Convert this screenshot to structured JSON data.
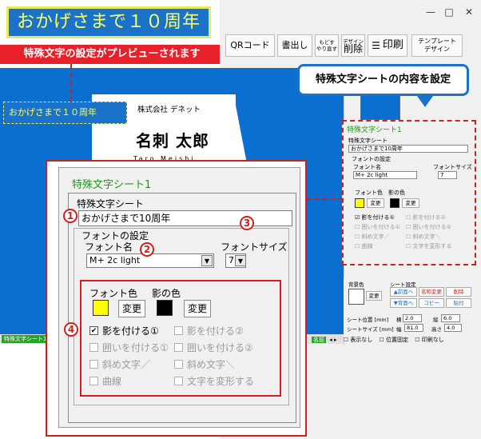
{
  "preview_banner": {
    "text": "おかげさまで１０周年",
    "caption": "特殊文字の設定がプレビューされます"
  },
  "window": {
    "minimize": "—",
    "maximize": "□",
    "close": "✕"
  },
  "toolbar": {
    "qr": "QRコード",
    "write": "書出し",
    "undo_line1": "もどす",
    "undo_line2": "やり直す",
    "delete_line1": "デザイン",
    "delete_line2": "削除",
    "print": "印刷",
    "template_line1": "テンプレート",
    "template_line2": "デザイン"
  },
  "card": {
    "special_text": "おかげさまで１０周年",
    "company": "株式会社 デネット",
    "name": "名刺 太郎",
    "romaji": "Taro Meishi"
  },
  "callout": "特殊文字シートの内容を設定",
  "small_panel": {
    "title": "特殊文字シート1",
    "sheet_label": "特殊文字シート",
    "sheet_value": "おかげさまで10周年",
    "font_group": "フォントの設定",
    "font_name_label": "フォント名",
    "font_size_label": "フォントサイズ",
    "font_value": "M+ 2c light",
    "size_value": "7",
    "font_color": "フォント色",
    "shadow_color": "影の色",
    "change": "変更",
    "opts": [
      "影を付ける①",
      "影を付ける②",
      "囲いを付ける①",
      "囲いを付ける②",
      "斜め文字／",
      "斜め文字＼",
      "曲線",
      "文字を変形する"
    ]
  },
  "bottom_panel": {
    "bg_label": "背景色",
    "change": "変更",
    "sheet_settings": "シート設定",
    "front": "▲前面へ",
    "rename": "名称変更",
    "del": "削除",
    "back": "▼背面へ",
    "copy": "コピー",
    "paste": "貼付",
    "pos_label": "シート位置 [mm]",
    "x_label": "横",
    "x_value": "2.0",
    "y_label": "縦",
    "y_value": "6.0",
    "size_label": "シートサイズ [mm]",
    "w_label": "幅",
    "w_value": "81.0",
    "h_label": "高さ",
    "h_value": "4.0"
  },
  "status": {
    "tag_left": "特殊文字シート1",
    "tag_mid": "名前",
    "hide": "表示なし",
    "fixed": "位置固定",
    "noprint": "印刷なし"
  },
  "big_panel": {
    "title": "特殊文字シート1",
    "sheet_label": "特殊文字シート",
    "sheet_value": "おかげさまで10周年",
    "font_group": "フォントの設定",
    "font_name_label": "フォント名",
    "font_size_label": "フォントサイズ",
    "font_value": "M+ 2c light",
    "size_value": "7",
    "font_color_label": "フォント色",
    "shadow_color_label": "影の色",
    "change": "変更",
    "font_color": "#ffff00",
    "shadow_color": "#000000",
    "opts": [
      "影を付ける①",
      "影を付ける②",
      "囲いを付ける①",
      "囲いを付ける②",
      "斜め文字／",
      "斜め文字＼",
      "曲線",
      "文字を変形する"
    ],
    "markers": [
      "1",
      "2",
      "3",
      "4"
    ]
  },
  "colors": {
    "canvas_blue": "#0b6fd0",
    "accent_red": "#d0201e",
    "title_green": "#1a9a1a",
    "highlight_yellow": "#ffff66"
  }
}
